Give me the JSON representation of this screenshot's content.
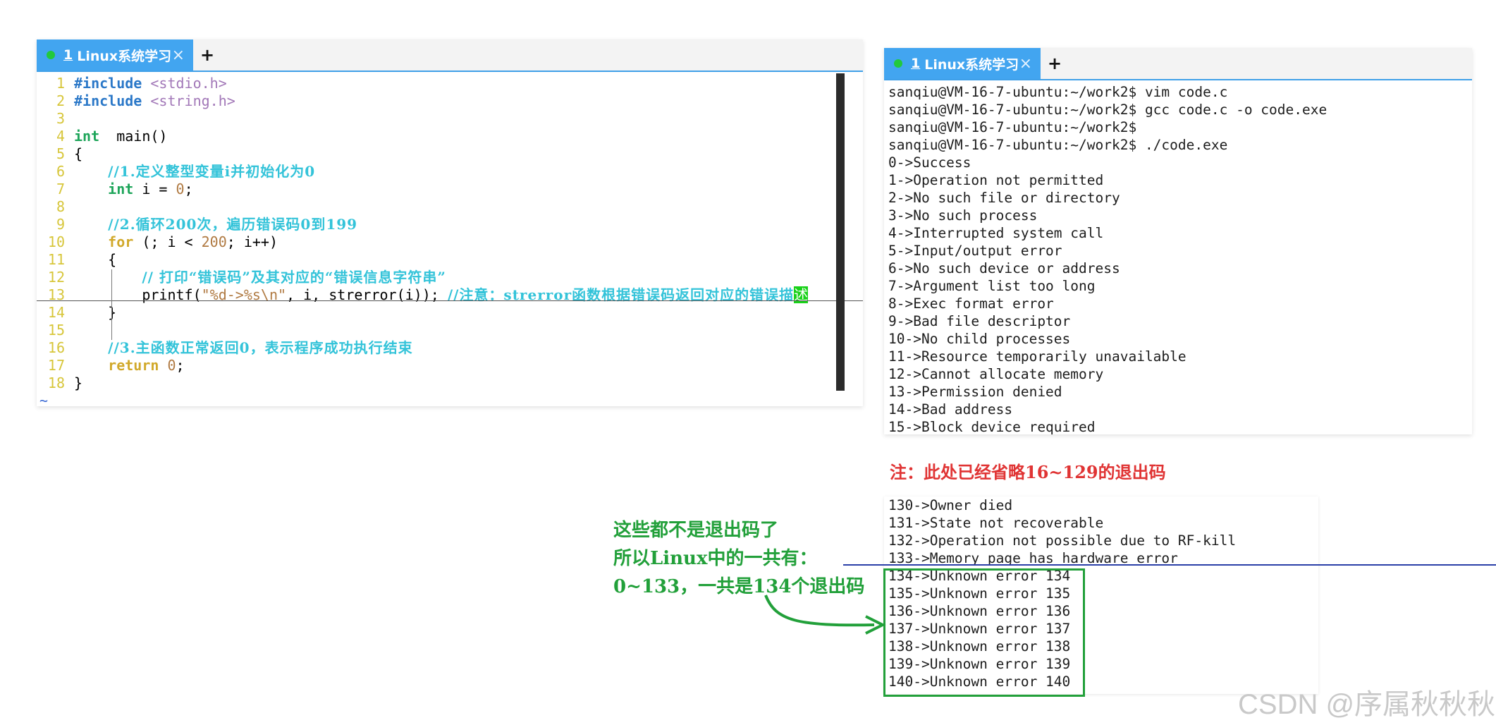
{
  "editor": {
    "tab_label": "1 Linux系统学习",
    "tab_num": "1",
    "tab_title": "Linux系统学习",
    "close": "×",
    "plus": "+",
    "tilde": "~",
    "lines": [
      {
        "n": "1",
        "segs": [
          [
            "kw",
            "#include "
          ],
          [
            "incl",
            "<stdio.h>"
          ]
        ]
      },
      {
        "n": "2",
        "segs": [
          [
            "kw",
            "#include "
          ],
          [
            "incl",
            "<string.h>"
          ]
        ]
      },
      {
        "n": "3",
        "segs": []
      },
      {
        "n": "4",
        "segs": [
          [
            "type",
            "int"
          ],
          [
            "",
            "  main()"
          ]
        ]
      },
      {
        "n": "5",
        "segs": [
          [
            "",
            "{"
          ]
        ]
      },
      {
        "n": "6",
        "segs": [
          [
            "",
            "    "
          ],
          [
            "cmt",
            "//1.定义整型变量i并初始化为0"
          ]
        ]
      },
      {
        "n": "7",
        "segs": [
          [
            "",
            "    "
          ],
          [
            "type",
            "int"
          ],
          [
            "",
            " i = "
          ],
          [
            "numlit",
            "0"
          ],
          [
            "",
            ";"
          ]
        ]
      },
      {
        "n": "8",
        "segs": []
      },
      {
        "n": "9",
        "segs": [
          [
            "",
            "    "
          ],
          [
            "cmt",
            "//2.循环200次，遍历错误码0到199"
          ]
        ]
      },
      {
        "n": "10",
        "segs": [
          [
            "",
            "    "
          ],
          [
            "ctrl",
            "for"
          ],
          [
            "",
            " (; i < "
          ],
          [
            "numlit",
            "200"
          ],
          [
            "",
            "; i++)"
          ]
        ]
      },
      {
        "n": "11",
        "segs": [
          [
            "",
            "    {"
          ]
        ]
      },
      {
        "n": "12",
        "segs": [
          [
            "",
            "        "
          ],
          [
            "cmt",
            "// 打印“错误码”及其对应的“错误信息字符串”"
          ]
        ]
      },
      {
        "n": "13",
        "segs": [
          [
            "",
            "        printf("
          ],
          [
            "str",
            "\"%d->%s\\n\""
          ],
          [
            "",
            ", i, strerror(i)); "
          ],
          [
            "cmt",
            "//注意：strerror函数根据错误码返回对应的错误描"
          ],
          [
            "hlword",
            "述"
          ]
        ]
      },
      {
        "n": "14",
        "segs": [
          [
            "",
            "    }"
          ]
        ]
      },
      {
        "n": "15",
        "segs": []
      },
      {
        "n": "16",
        "segs": [
          [
            "",
            "    "
          ],
          [
            "cmt",
            "//3.主函数正常返回0，表示程序成功执行结束"
          ]
        ]
      },
      {
        "n": "17",
        "segs": [
          [
            "",
            "    "
          ],
          [
            "ctrl",
            "return"
          ],
          [
            "",
            " "
          ],
          [
            "numlit",
            "0"
          ],
          [
            "",
            ";"
          ]
        ]
      },
      {
        "n": "18",
        "segs": [
          [
            "",
            "}"
          ]
        ]
      }
    ]
  },
  "terminal": {
    "tab_num": "1",
    "tab_title": "Linux系统学习",
    "close": "×",
    "plus": "+",
    "lines": [
      "sanqiu@VM-16-7-ubuntu:~/work2$ vim code.c",
      "sanqiu@VM-16-7-ubuntu:~/work2$ gcc code.c -o code.exe",
      "sanqiu@VM-16-7-ubuntu:~/work2$",
      "sanqiu@VM-16-7-ubuntu:~/work2$ ./code.exe",
      "0->Success",
      "1->Operation not permitted",
      "2->No such file or directory",
      "3->No such process",
      "4->Interrupted system call",
      "5->Input/output error",
      "6->No such device or address",
      "7->Argument list too long",
      "8->Exec format error",
      "9->Bad file descriptor",
      "10->No child processes",
      "11->Resource temporarily unavailable",
      "12->Cannot allocate memory",
      "13->Permission denied",
      "14->Bad address",
      "15->Block device required"
    ]
  },
  "note": "注：此处已经省略16~129的退出码",
  "terminal2": {
    "lines": [
      "130->Owner died",
      "131->State not recoverable",
      "132->Operation not possible due to RF-kill",
      "133->Memory page has hardware error",
      "134->Unknown error 134",
      "135->Unknown error 135",
      "136->Unknown error 136",
      "137->Unknown error 137",
      "138->Unknown error 138",
      "139->Unknown error 139",
      "140->Unknown error 140"
    ]
  },
  "annotation": {
    "line1": "这些都不是退出码了",
    "line2": "所以Linux中的一共有：",
    "line3": "0~133，一共是134个退出码"
  },
  "watermark": "CSDN @序属秋秋秋",
  "colors": {
    "tab_bg": "#42a5f0",
    "annotation": "#22a03a",
    "note": "#e03434",
    "underline": "#2a3fa8"
  }
}
